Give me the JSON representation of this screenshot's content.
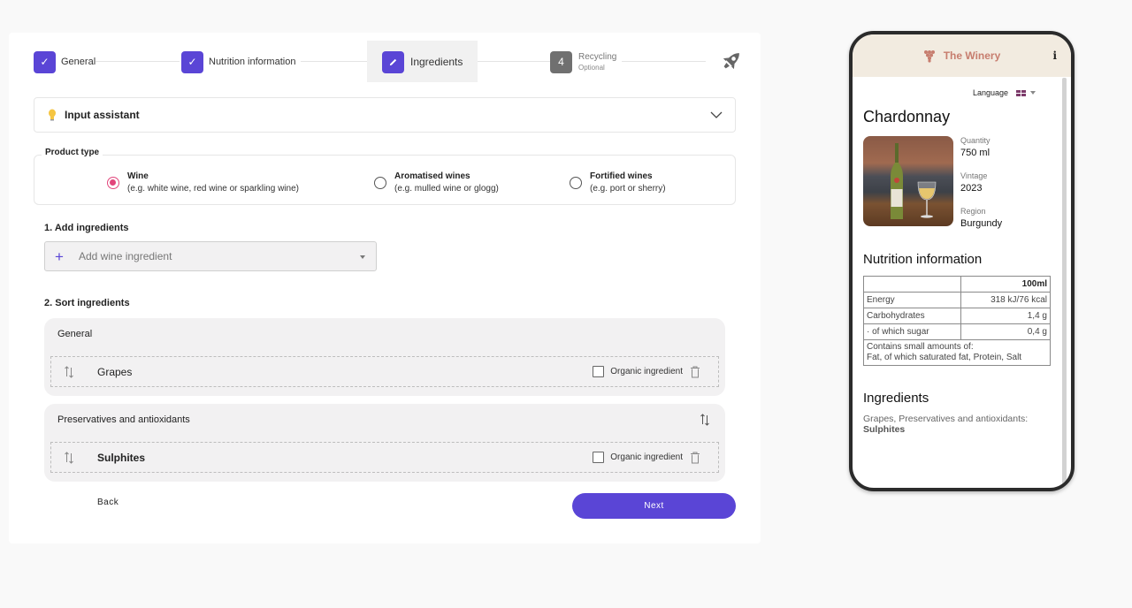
{
  "stepper": {
    "steps": [
      {
        "label": "General",
        "state": "done",
        "icon": "check-icon"
      },
      {
        "label": "Nutrition information",
        "state": "done",
        "icon": "check-icon"
      },
      {
        "label": "Ingredients",
        "state": "active",
        "icon": "pencil-icon"
      },
      {
        "number": "4",
        "label": "Recycling",
        "sublabel": "Optional",
        "state": "pending"
      }
    ],
    "final_icon": "rocket-icon"
  },
  "input_assistant": {
    "label": "Input assistant",
    "icon": "lightbulb-icon",
    "expand_icon": "chevron-down-icon"
  },
  "product_type": {
    "legend": "Product type",
    "options": [
      {
        "label": "Wine",
        "hint": "(e.g. white wine, red wine or sparkling wine)",
        "selected": true
      },
      {
        "label": "Aromatised wines",
        "hint": "(e.g. mulled wine or glogg)",
        "selected": false
      },
      {
        "label": "Fortified wines",
        "hint": "(e.g. port or sherry)",
        "selected": false
      }
    ]
  },
  "add_ingredients": {
    "title": "1. Add ingredients",
    "placeholder": "Add wine ingredient"
  },
  "sort_ingredients": {
    "title": "2. Sort ingredients",
    "groups": [
      {
        "title": "General",
        "items": [
          {
            "name": "Grapes",
            "organic_label": "Organic ingredient",
            "organic": false
          }
        ]
      },
      {
        "title": "Preservatives and antioxidants",
        "items": [
          {
            "name": "Sulphites",
            "organic_label": "Organic ingredient",
            "organic": false
          }
        ]
      }
    ]
  },
  "footer": {
    "back_label": "Back",
    "next_label": "Next"
  },
  "colors": {
    "accent": "#5a45d6",
    "radio_selected": "#e2457b",
    "brand": "#c77d6e",
    "phone_header_bg": "#f2ebe0"
  },
  "preview": {
    "brand": "The Winery",
    "info_icon": "i",
    "language_label": "Language",
    "wine_name": "Chardonnay",
    "meta": [
      {
        "key": "Quantity",
        "value": "750 ml"
      },
      {
        "key": "Vintage",
        "value": "2023"
      },
      {
        "key": "Region",
        "value": "Burgundy"
      }
    ],
    "nutrition": {
      "title": "Nutrition information",
      "column": "100ml",
      "rows": [
        {
          "label": "Energy",
          "value": "318 kJ/76 kcal"
        },
        {
          "label": "Carbohydrates",
          "value": "1,4 g"
        },
        {
          "label": "· of which sugar",
          "value": "0,4 g"
        }
      ],
      "footnote_line1": "Contains small amounts of:",
      "footnote_line2": "Fat, of which saturated fat, Protein, Salt"
    },
    "ingredients": {
      "title": "Ingredients",
      "text": "Grapes, Preservatives and antioxidants:",
      "bold": "Sulphites"
    }
  }
}
